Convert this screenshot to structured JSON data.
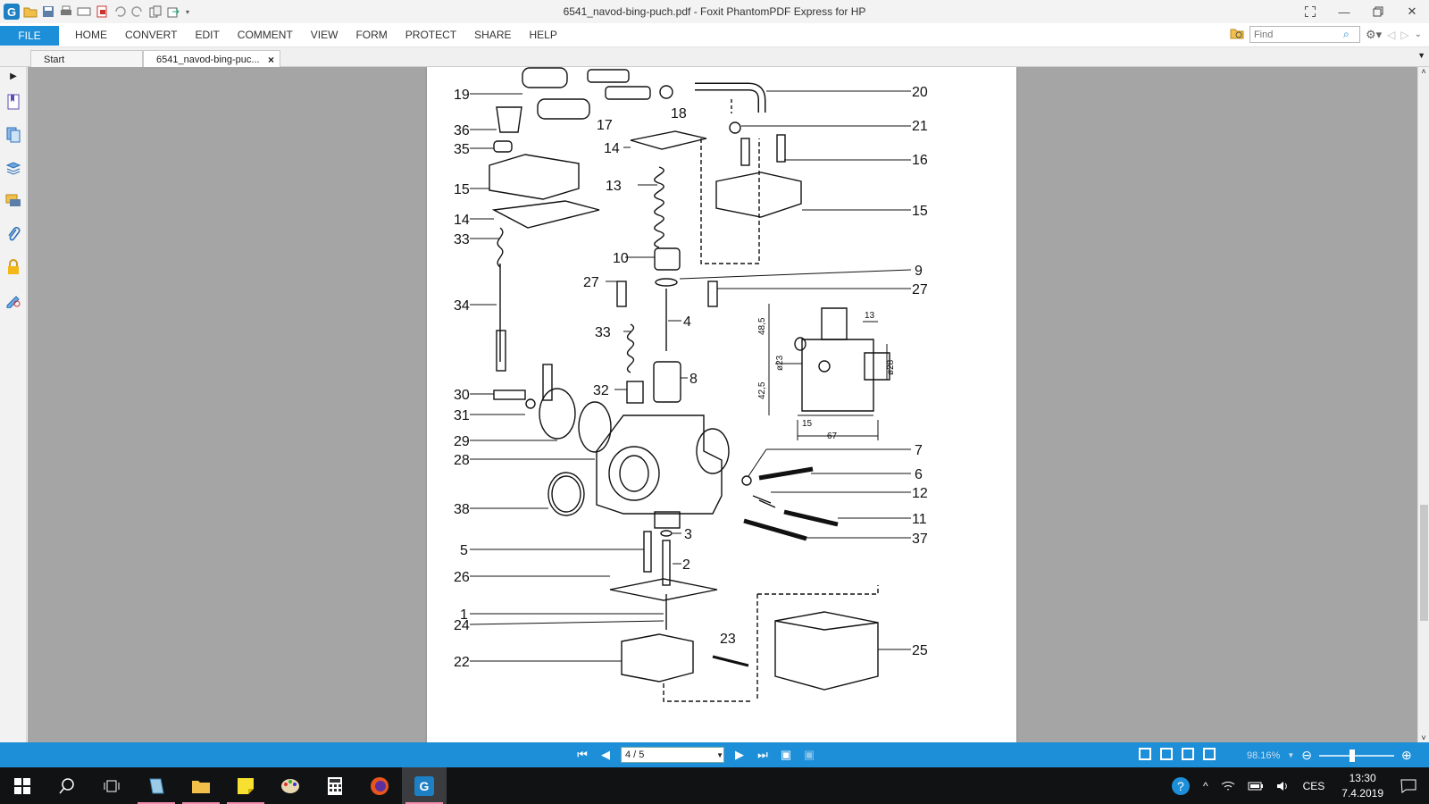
{
  "window": {
    "title": "6541_navod-bing-puch.pdf - Foxit PhantomPDF Express for HP",
    "app_icon": "foxit-logo-icon"
  },
  "menu": {
    "file": "FILE",
    "items": [
      "HOME",
      "CONVERT",
      "EDIT",
      "COMMENT",
      "VIEW",
      "FORM",
      "PROTECT",
      "SHARE",
      "HELP"
    ],
    "find_placeholder": "Find"
  },
  "tabs": [
    {
      "label": "Start"
    },
    {
      "label": "6541_navod-bing-puc...",
      "close": "×"
    }
  ],
  "diagram": {
    "part_labels": [
      "19",
      "20",
      "18",
      "17",
      "21",
      "36",
      "14",
      "16",
      "35",
      "15",
      "13",
      "15",
      "14",
      "33",
      "10",
      "9",
      "27",
      "27",
      "34",
      "4",
      "33",
      "8",
      "30",
      "32",
      "31",
      "29",
      "28",
      "7",
      "6",
      "12",
      "38",
      "11",
      "37",
      "3",
      "5",
      "2",
      "26",
      "1",
      "24",
      "23",
      "25",
      "22"
    ],
    "dimensions": [
      "48,5",
      "13",
      "ø23",
      "ø28",
      "42,5",
      "15",
      "67"
    ]
  },
  "status": {
    "page_value": "4 / 5",
    "zoom": "98.16%"
  },
  "accent_color": "#1d8fd8",
  "taskbar": {
    "language": "CES",
    "time": "13:30",
    "date": "7.4.2019"
  }
}
